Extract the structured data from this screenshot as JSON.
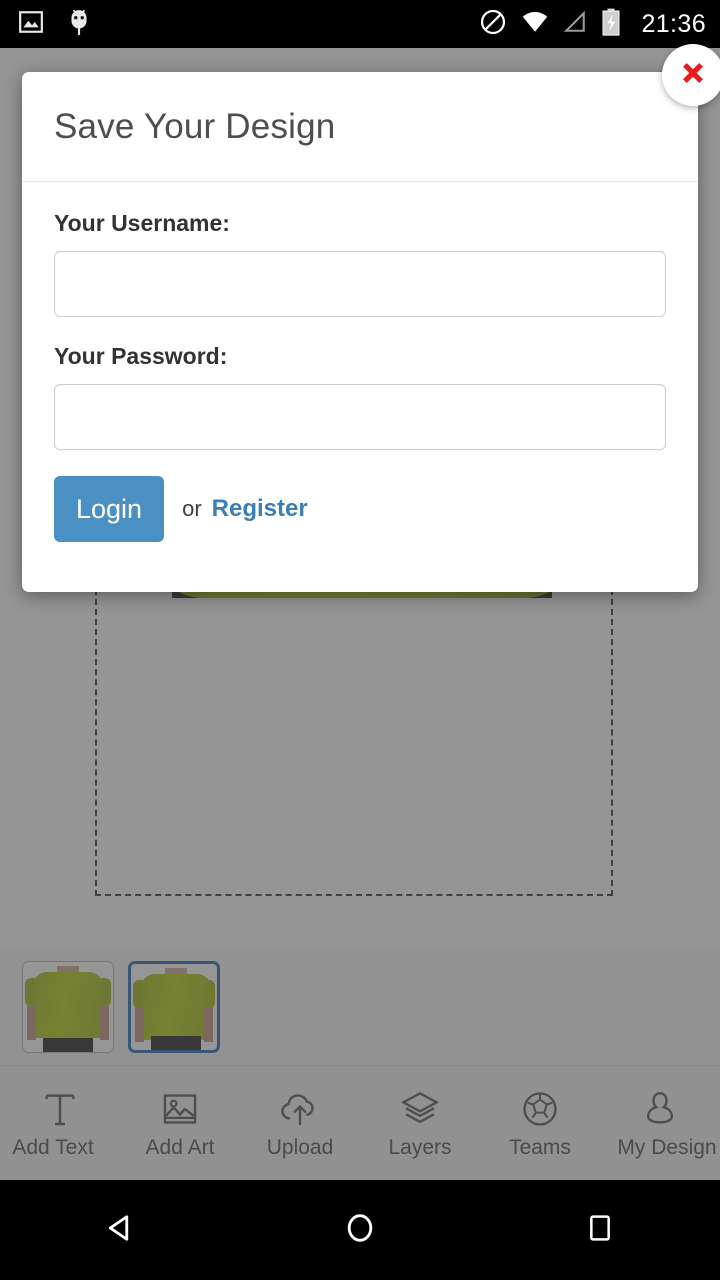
{
  "status_bar": {
    "time": "21:36",
    "left_icons": [
      {
        "name": "photo-icon"
      },
      {
        "name": "android-debug-icon"
      }
    ],
    "right_icons": [
      {
        "name": "do-not-disturb-icon"
      },
      {
        "name": "wifi-icon"
      },
      {
        "name": "cell-signal-icon"
      },
      {
        "name": "battery-charging-icon"
      }
    ],
    "background": "#000000",
    "foreground": "#ffffff"
  },
  "dialog": {
    "title": "Save Your Design",
    "close_label": "✖",
    "username": {
      "label": "Your Username:",
      "value": "",
      "placeholder": ""
    },
    "password": {
      "label": "Your Password:",
      "value": "",
      "placeholder": ""
    },
    "login_label": "Login",
    "or_label": "or",
    "register_label": "Register",
    "accent_color": "#4a90c2",
    "link_color": "#3a7fb8",
    "close_color": "#e81c1c"
  },
  "designer": {
    "selection_label": "design-selection-box",
    "shirt_color": "#b0c80a",
    "art_color": "#14148f",
    "thumbnails": [
      {
        "name": "thumbnail-front",
        "view": "Front",
        "selected": false
      },
      {
        "name": "thumbnail-back",
        "view": "Back",
        "selected": true
      }
    ],
    "selected_border_color": "#1763ad"
  },
  "toolbar": {
    "items": [
      {
        "label": "Add Text",
        "icon": "text-icon"
      },
      {
        "label": "Add Art",
        "icon": "image-icon"
      },
      {
        "label": "Upload",
        "icon": "cloud-upload-icon"
      },
      {
        "label": "Layers",
        "icon": "layers-icon"
      },
      {
        "label": "Teams",
        "icon": "soccer-ball-icon"
      },
      {
        "label": "My Design",
        "icon": "person-icon"
      }
    ]
  },
  "nav_bar": {
    "buttons": [
      {
        "name": "back-button",
        "icon": "triangle-left-icon"
      },
      {
        "name": "home-button",
        "icon": "circle-icon"
      },
      {
        "name": "recents-button",
        "icon": "square-icon"
      }
    ]
  }
}
